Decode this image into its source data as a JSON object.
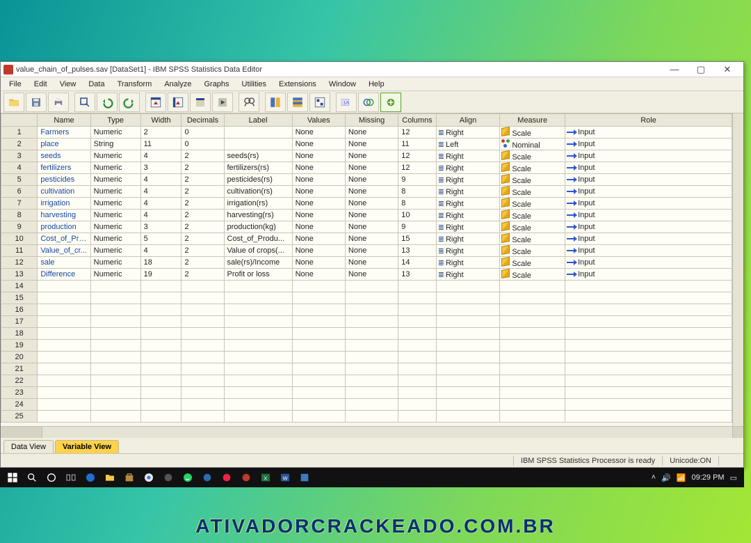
{
  "window": {
    "title": "value_chain_of_pulses.sav [DataSet1] - IBM SPSS Statistics Data Editor",
    "controls": {
      "min": "—",
      "max": "▢",
      "close": "✕"
    }
  },
  "menubar": [
    "File",
    "Edit",
    "View",
    "Data",
    "Transform",
    "Analyze",
    "Graphs",
    "Utilities",
    "Extensions",
    "Window",
    "Help"
  ],
  "columns": [
    "Name",
    "Type",
    "Width",
    "Decimals",
    "Label",
    "Values",
    "Missing",
    "Columns",
    "Align",
    "Measure",
    "Role"
  ],
  "rows": [
    {
      "n": 1,
      "name": "Farmers",
      "type": "Numeric",
      "width": "2",
      "decimals": "0",
      "label": "",
      "values": "None",
      "missing": "None",
      "columns": "12",
      "align": "Right",
      "measure": "Scale",
      "role": "Input"
    },
    {
      "n": 2,
      "name": "place",
      "type": "String",
      "width": "11",
      "decimals": "0",
      "label": "",
      "values": "None",
      "missing": "None",
      "columns": "11",
      "align": "Left",
      "measure": "Nominal",
      "role": "Input"
    },
    {
      "n": 3,
      "name": "seeds",
      "type": "Numeric",
      "width": "4",
      "decimals": "2",
      "label": "seeds(rs)",
      "values": "None",
      "missing": "None",
      "columns": "12",
      "align": "Right",
      "measure": "Scale",
      "role": "Input"
    },
    {
      "n": 4,
      "name": "fertilizers",
      "type": "Numeric",
      "width": "3",
      "decimals": "2",
      "label": "fertilizers(rs)",
      "values": "None",
      "missing": "None",
      "columns": "12",
      "align": "Right",
      "measure": "Scale",
      "role": "Input"
    },
    {
      "n": 5,
      "name": "pesticides",
      "type": "Numeric",
      "width": "4",
      "decimals": "2",
      "label": "pesticides(rs)",
      "values": "None",
      "missing": "None",
      "columns": "9",
      "align": "Right",
      "measure": "Scale",
      "role": "Input"
    },
    {
      "n": 6,
      "name": "cultivation",
      "type": "Numeric",
      "width": "4",
      "decimals": "2",
      "label": "cultivation(rs)",
      "values": "None",
      "missing": "None",
      "columns": "8",
      "align": "Right",
      "measure": "Scale",
      "role": "Input"
    },
    {
      "n": 7,
      "name": "irrigation",
      "type": "Numeric",
      "width": "4",
      "decimals": "2",
      "label": "irrigation(rs)",
      "values": "None",
      "missing": "None",
      "columns": "8",
      "align": "Right",
      "measure": "Scale",
      "role": "Input"
    },
    {
      "n": 8,
      "name": "harvesting",
      "type": "Numeric",
      "width": "4",
      "decimals": "2",
      "label": "harvesting(rs)",
      "values": "None",
      "missing": "None",
      "columns": "10",
      "align": "Right",
      "measure": "Scale",
      "role": "Input"
    },
    {
      "n": 9,
      "name": "production",
      "type": "Numeric",
      "width": "3",
      "decimals": "2",
      "label": "production(kg)",
      "values": "None",
      "missing": "None",
      "columns": "9",
      "align": "Right",
      "measure": "Scale",
      "role": "Input"
    },
    {
      "n": 10,
      "name": "Cost_of_Pro...",
      "type": "Numeric",
      "width": "5",
      "decimals": "2",
      "label": "Cost_of_Produ...",
      "values": "None",
      "missing": "None",
      "columns": "15",
      "align": "Right",
      "measure": "Scale",
      "role": "Input"
    },
    {
      "n": 11,
      "name": "Value_of_cr...",
      "type": "Numeric",
      "width": "4",
      "decimals": "2",
      "label": "Value of crops(...",
      "values": "None",
      "missing": "None",
      "columns": "13",
      "align": "Right",
      "measure": "Scale",
      "role": "Input"
    },
    {
      "n": 12,
      "name": "sale",
      "type": "Numeric",
      "width": "18",
      "decimals": "2",
      "label": "sale(rs)/Income",
      "values": "None",
      "missing": "None",
      "columns": "14",
      "align": "Right",
      "measure": "Scale",
      "role": "Input"
    },
    {
      "n": 13,
      "name": "Difference",
      "type": "Numeric",
      "width": "19",
      "decimals": "2",
      "label": "Profit or loss",
      "values": "None",
      "missing": "None",
      "columns": "13",
      "align": "Right",
      "measure": "Scale",
      "role": "Input"
    }
  ],
  "empty_rows_start": 14,
  "empty_rows_end": 25,
  "tabs": {
    "data": "Data View",
    "variable": "Variable View"
  },
  "statusbar": {
    "processor": "IBM SPSS Statistics Processor is ready",
    "unicode": "Unicode:ON"
  },
  "taskbar": {
    "time": "09:29 PM"
  },
  "watermark": "ATIVADORCRACKEADO.COM.BR"
}
